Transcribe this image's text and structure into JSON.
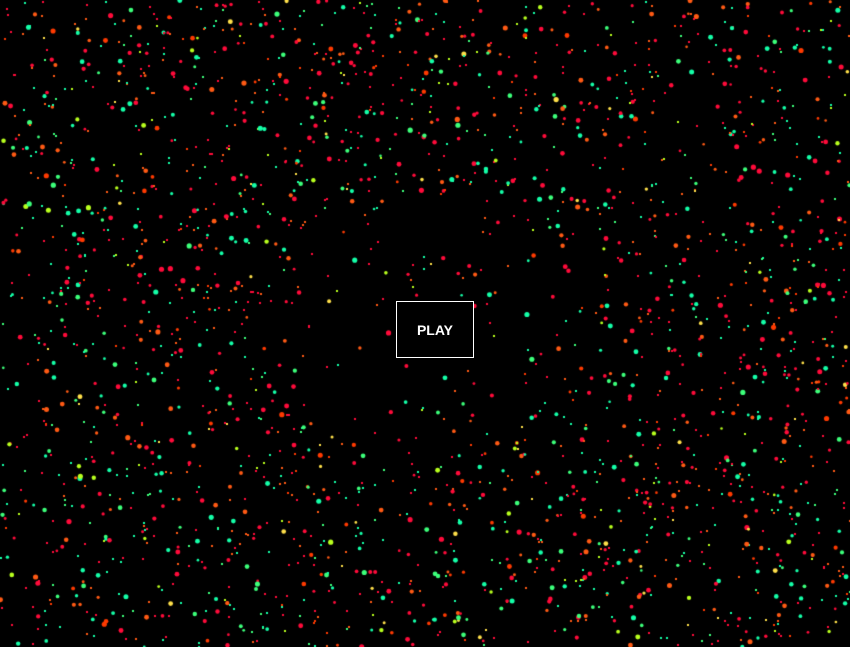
{
  "game": {
    "play_label": "PLAY",
    "background_color": "#000000",
    "particle_colors": [
      "#ff0b3a",
      "#ff5a14",
      "#ff3a00",
      "#14ffa8",
      "#3cff7a",
      "#b8ff1e",
      "#ffe04a"
    ]
  }
}
